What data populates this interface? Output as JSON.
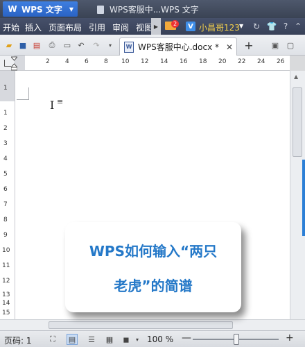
{
  "titlebar": {
    "app_name": "WPS 文字",
    "app_logo": "W",
    "doc_title": "WPS客服中...WPS 文字"
  },
  "menu": {
    "items": [
      "开始",
      "插入",
      "页面布局",
      "引用",
      "审阅",
      "视图"
    ],
    "mail_badge": "2",
    "vip_label": "V",
    "user_name": "小昌哥123"
  },
  "tabs": {
    "active_label": "WPS客服中心.docx *",
    "file_icon_letter": "W",
    "close_glyph": "✕",
    "new_tab_glyph": "+"
  },
  "ruler": {
    "h_numbers": [
      "2",
      "4",
      "6",
      "8",
      "10",
      "12",
      "14",
      "16",
      "18",
      "20",
      "22",
      "24",
      "26"
    ],
    "v_numbers": [
      "1",
      "1",
      "2",
      "3",
      "4",
      "5",
      "6",
      "7",
      "8",
      "9",
      "10",
      "11",
      "12",
      "13",
      "14",
      "15"
    ]
  },
  "statusbar": {
    "page_label": "页码: 1",
    "zoom": "100 %",
    "zoom_minus": "—",
    "zoom_plus": "+"
  },
  "overlay": {
    "line1": "WPS如何输入“两只",
    "line2": "老虎”的简谱"
  },
  "colors": {
    "accent_blue": "#2478c8",
    "title_bar": "#3a4354",
    "user_name": "#f6d24a"
  },
  "icons": {
    "toolbar": [
      "open-folder-icon",
      "save-icon",
      "pdf-export-icon",
      "print-icon",
      "print-preview-icon",
      "undo-icon",
      "redo-icon"
    ],
    "top_right": [
      "sync-icon",
      "shirt-skin-icon",
      "help-icon",
      "collapse-icon"
    ]
  }
}
